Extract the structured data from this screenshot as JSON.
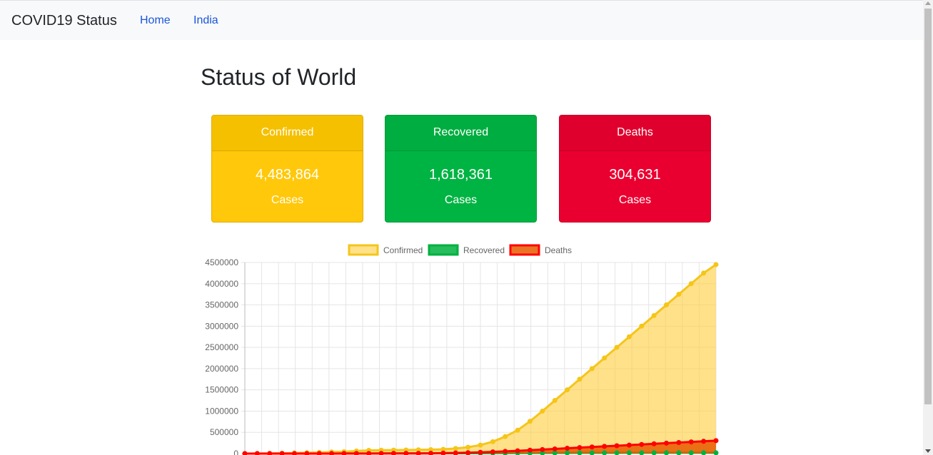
{
  "navbar": {
    "brand": "COVID19 Status",
    "links": [
      "Home",
      "India"
    ]
  },
  "page": {
    "title": "Status of World"
  },
  "cards": [
    {
      "label": "Confirmed",
      "value": "4,483,864",
      "unit": "Cases",
      "color": "#ffc107"
    },
    {
      "label": "Recovered",
      "value": "1,618,361",
      "unit": "Cases",
      "color": "#00b140"
    },
    {
      "label": "Deaths",
      "value": "304,631",
      "unit": "Cases",
      "color": "#e8002d"
    }
  ],
  "chart_data": {
    "type": "area",
    "ylim": [
      0,
      4500000
    ],
    "yticks": [
      "4500000",
      "4000000",
      "3500000",
      "3000000",
      "2500000",
      "2000000",
      "1500000",
      "1000000",
      "500000",
      "0"
    ],
    "legend_position": "top",
    "grid": true,
    "series": [
      {
        "name": "Confirmed",
        "color": "#f5c518",
        "fill": "rgba(255,205,60,0.6)",
        "values": [
          0,
          2000,
          5000,
          9000,
          14000,
          20000,
          28000,
          37000,
          45000,
          60000,
          75000,
          80000,
          82000,
          85000,
          88000,
          92000,
          100000,
          120000,
          150000,
          200000,
          280000,
          400000,
          550000,
          760000,
          1000000,
          1250000,
          1500000,
          1750000,
          2000000,
          2250000,
          2500000,
          2750000,
          3000000,
          3250000,
          3500000,
          3750000,
          4000000,
          4250000,
          4450000
        ]
      },
      {
        "name": "Recovered",
        "color": "#00b140",
        "fill": "rgba(0,177,64,0.85)",
        "values": [
          0,
          0,
          0,
          0,
          100,
          300,
          600,
          1000,
          1500,
          2000,
          2500,
          3000,
          3500,
          4000,
          4500,
          5000,
          6000,
          7000,
          8000,
          9000,
          10000,
          11000,
          12000,
          13000,
          14000,
          15000,
          15500,
          16000,
          16500,
          17000,
          17500,
          18000,
          18000,
          18000,
          18000,
          18000,
          18000,
          18000,
          18000
        ]
      },
      {
        "name": "Deaths",
        "color": "#ff0000",
        "fill": "rgba(230,90,0,0.85)",
        "values": [
          0,
          0,
          0,
          0,
          100,
          200,
          500,
          800,
          1200,
          1800,
          2500,
          3200,
          3600,
          4000,
          5000,
          7000,
          10000,
          15000,
          22000,
          30000,
          40000,
          52000,
          65000,
          80000,
          95000,
          110000,
          125000,
          140000,
          155000,
          170000,
          185000,
          200000,
          215000,
          230000,
          245000,
          260000,
          275000,
          290000,
          304631
        ]
      }
    ]
  }
}
